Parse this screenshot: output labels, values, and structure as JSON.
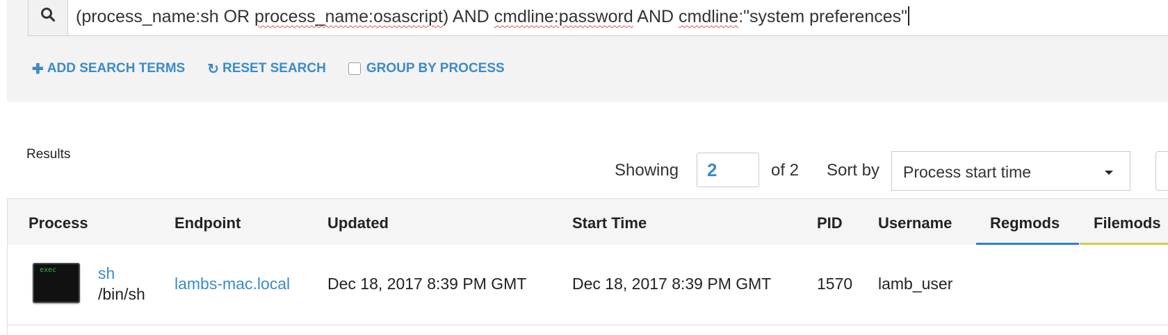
{
  "search": {
    "query_parts": {
      "p1": "(process_name:sh OR ",
      "p2": "process_name:osascript",
      "p3": ") AND ",
      "p4": "cmdline:password",
      "p5": " AND ",
      "p6": "cmdline",
      "p7": ":\"system preferences\""
    },
    "icon": "search-icon"
  },
  "actions": {
    "add_terms": "ADD SEARCH TERMS",
    "reset": "RESET SEARCH",
    "group_by_process": "GROUP BY PROCESS",
    "group_by_checked": false
  },
  "results": {
    "label": "Results",
    "showing_label": "Showing",
    "page_value": "2",
    "of_label": "of 2",
    "sort_label": "Sort by",
    "sort_value": "Process start time"
  },
  "table": {
    "headers": {
      "process": "Process",
      "endpoint": "Endpoint",
      "updated": "Updated",
      "start_time": "Start Time",
      "pid": "PID",
      "username": "Username",
      "regmods": "Regmods",
      "filemods": "Filemods"
    },
    "rows": [
      {
        "thumb_text": "exec",
        "process_name": "sh",
        "process_path": "/bin/sh",
        "endpoint": "lambs-mac.local",
        "updated": "Dec 18, 2017 8:39 PM GMT",
        "start_time": "Dec 18, 2017 8:39 PM GMT",
        "pid": "1570",
        "username": "lamb_user"
      }
    ]
  },
  "colors": {
    "accent": "#3b8bc9",
    "regmods_tab": "#2d7fd3",
    "filemods_tab": "#d4c94a"
  }
}
